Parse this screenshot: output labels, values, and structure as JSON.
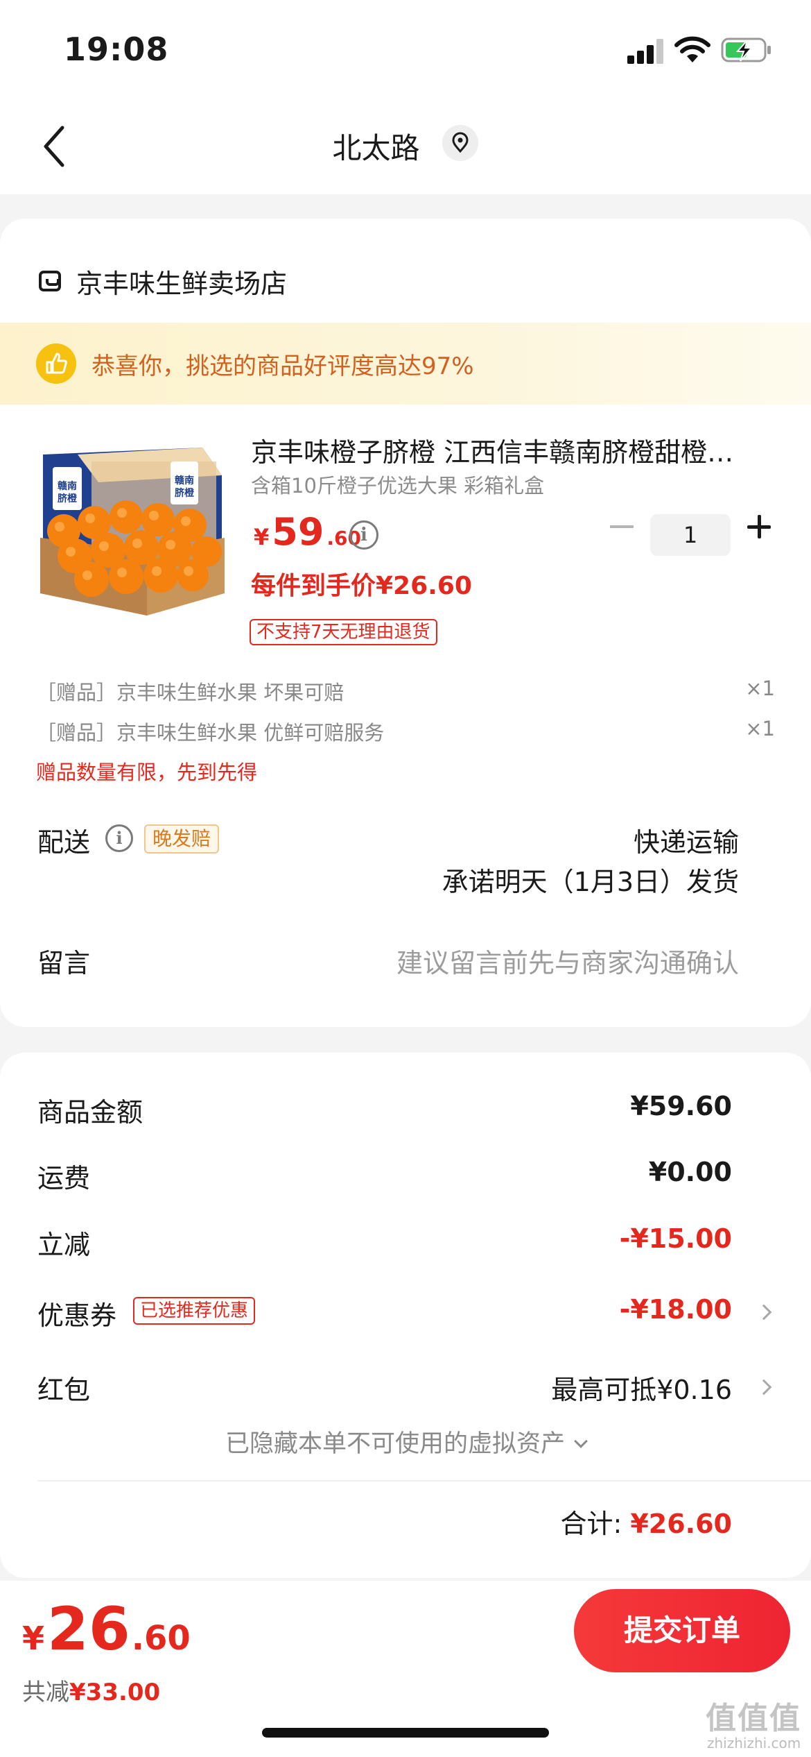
{
  "status_bar": {
    "time": "19:08"
  },
  "nav": {
    "title": "北太路"
  },
  "store": {
    "name": "京丰味生鲜卖场店"
  },
  "banner": {
    "text": "恭喜你，挑选的商品好评度高达97%"
  },
  "product": {
    "title": "京丰味橙子脐橙 江西信丰赣南脐橙甜橙…",
    "spec": "含箱10斤橙子优选大果 彩箱礼盒",
    "price_symbol": "¥",
    "price_int": "59",
    "price_dec": ".60",
    "quantity": "1",
    "unit_price": "每件到手价¥26.60",
    "return_policy": "不支持7天无理由退货",
    "image_text": "赣南脐橙"
  },
  "gifts": [
    {
      "label": "［赠品］京丰味生鲜水果 坏果可赔",
      "qty": "×1"
    },
    {
      "label": "［赠品］京丰味生鲜水果 优鲜可赔服务",
      "qty": "×1"
    }
  ],
  "gift_warning": "赠品数量有限，先到先得",
  "delivery": {
    "label": "配送",
    "badge": "晚发赔",
    "method": "快递运输",
    "date": "承诺明天（1月3日）发货"
  },
  "message": {
    "label": "留言",
    "placeholder": "建议留言前先与商家沟通确认"
  },
  "price_breakdown": {
    "goods_label": "商品金额",
    "goods_value": "¥59.60",
    "shipping_label": "运费",
    "shipping_value": "¥0.00",
    "discount_label": "立减",
    "discount_value": "-¥15.00",
    "coupon_label": "优惠券",
    "coupon_badge": "已选推荐优惠",
    "coupon_value": "-¥18.00",
    "redpacket_label": "红包",
    "redpacket_value": "最高可抵¥0.16",
    "hidden_assets": "已隐藏本单不可使用的虚拟资产",
    "total_label": "合计:",
    "total_value": "¥26.60"
  },
  "bottom_bar": {
    "price_symbol": "¥",
    "price_int": "26",
    "price_dec": ".60",
    "savings_label": "共减",
    "savings_value": "¥33.00",
    "submit_label": "提交订单"
  },
  "watermark": {
    "logo": "值值值",
    "url": "zhizhizhi.com"
  },
  "colors": {
    "accent_red": "#e4281e",
    "banner_bg": "#fdf2cc",
    "banner_text": "#d2611f",
    "badge_orange": "#d87a1e"
  }
}
